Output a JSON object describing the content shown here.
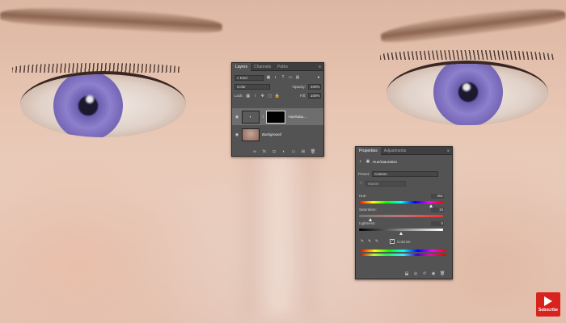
{
  "layers_panel": {
    "tabs": [
      "Layers",
      "Channels",
      "Paths"
    ],
    "filter_kind": "Kind",
    "blend_mode": "Color",
    "opacity_label": "Opacity:",
    "opacity_value": "100%",
    "lock_label": "Lock:",
    "fill_label": "Fill:",
    "fill_value": "100%",
    "layers": [
      {
        "name": "Hue/Satu...",
        "type": "adjustment"
      },
      {
        "name": "Background",
        "type": "image"
      }
    ]
  },
  "properties_panel": {
    "tabs": [
      "Properties",
      "Adjustments"
    ],
    "title": "Hue/Saturation",
    "preset_label": "Preset:",
    "preset_value": "Custom",
    "channel_value": "Master",
    "hue_label": "Hue:",
    "hue_value": "261",
    "hue_fraction": 0.86,
    "saturation_label": "Saturation:",
    "saturation_value": "15",
    "saturation_fraction": 0.14,
    "lightness_label": "Lightness:",
    "lightness_value": "0",
    "lightness_fraction": 0.5,
    "colorize_label": "Colorize",
    "colorize_checked": true
  },
  "subscribe": {
    "label": "Subscribe"
  }
}
